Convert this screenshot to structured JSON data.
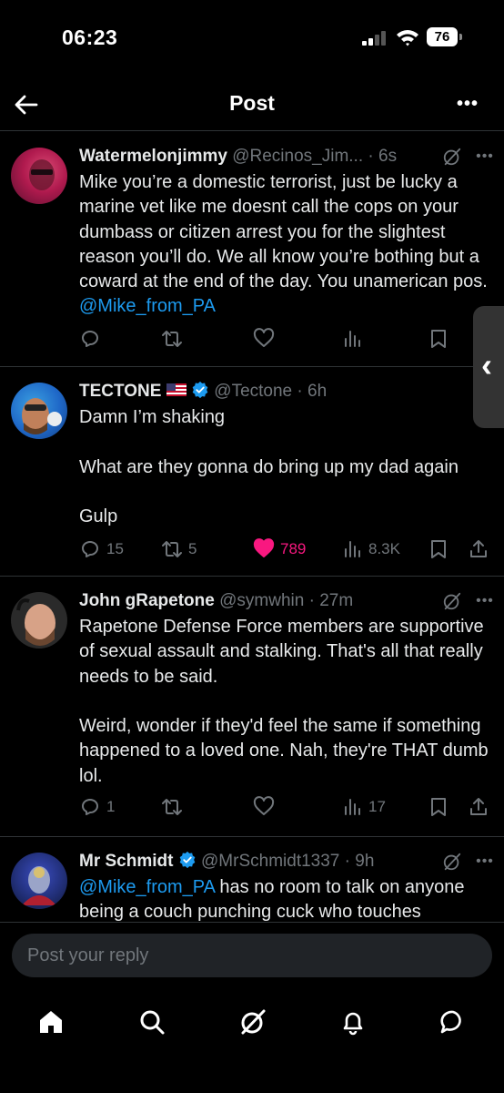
{
  "status_bar": {
    "time": "06:23",
    "battery": "76"
  },
  "header": {
    "title": "Post"
  },
  "posts": [
    {
      "author": "Watermelonjimmy",
      "handle": "@Recinos_Jim...",
      "time": "· 6s",
      "text_before": "Mike you’re a domestic terrorist, just be lucky a marine vet like me doesnt call the cops on your dumbass or citizen arrest you for the slightest reason you’ll do. We all know you’re bothing but a coward at the end of the day. You unamerican pos. ",
      "mention": "@Mike_from_PA",
      "text_after": "",
      "replies": "",
      "reposts": "",
      "likes": "",
      "views": ""
    },
    {
      "author": "TECTONE",
      "handle": "@Tectone",
      "time": "· 6h",
      "text_before": "Damn I’m shaking\n\nWhat are they gonna do bring up my dad again\n\nGulp",
      "mention": "",
      "text_after": "",
      "replies": "15",
      "reposts": "5",
      "likes": "789",
      "views": "8.3K"
    },
    {
      "author": "John gRapetone",
      "handle": "@symwhin",
      "time": "· 27m",
      "text_before": "Rapetone Defense Force members are supportive of sexual assault and stalking. That's all that really needs to be said.\n\nWeird, wonder if they'd feel the same if something happened to a loved one. Nah, they're THAT dumb lol.",
      "mention": "",
      "text_after": "",
      "replies": "1",
      "reposts": "",
      "likes": "",
      "views": "17"
    },
    {
      "author": "Mr Schmidt",
      "handle": "@MrSchmidt1337",
      "time": "· 9h",
      "text_before": "",
      "mention": "@Mike_from_PA",
      "text_after": " has no room to talk on anyone being a couch punching cuck who touches",
      "replies": "",
      "reposts": "",
      "likes": "",
      "views": ""
    }
  ],
  "reply": {
    "placeholder": "Post your reply"
  },
  "colors": {
    "background": "#000000",
    "accent": "#1d9bf0",
    "like": "#f91880",
    "muted": "#71767b",
    "divider": "#2f3336"
  },
  "tabs": [
    "home-icon",
    "search-icon",
    "grok-icon",
    "notifications-icon",
    "messages-icon"
  ]
}
